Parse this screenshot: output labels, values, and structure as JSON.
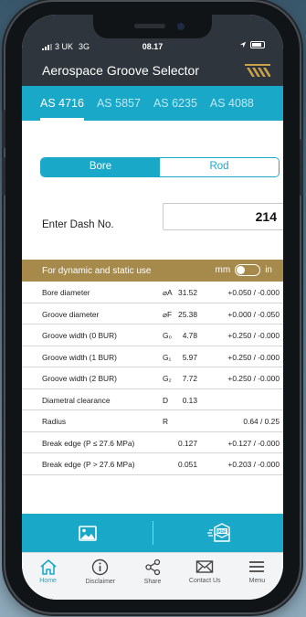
{
  "status": {
    "carrier": "3 UK",
    "network": "3G",
    "time": "08.17"
  },
  "app": {
    "title": "Aerospace Groove Selector",
    "logo_icon": "brand-logo-icon"
  },
  "tabs": [
    {
      "label": "AS 4716",
      "active": true
    },
    {
      "label": "AS 5857",
      "active": false
    },
    {
      "label": "AS 6235",
      "active": false
    },
    {
      "label": "AS 4088",
      "active": false
    }
  ],
  "segment": {
    "bore": "Bore",
    "rod": "Rod",
    "selected": "Bore"
  },
  "dash": {
    "label": "Enter Dash No.",
    "value": "214"
  },
  "usage": {
    "note": "For dynamic and static use",
    "unit_mm": "mm",
    "unit_in": "in",
    "selected_unit": "mm"
  },
  "table": {
    "rows": [
      {
        "name": "Bore diameter",
        "symbol": "⌀A",
        "value": "31.52",
        "tolerance": "+0.050 / -0.000"
      },
      {
        "name": "Groove diameter",
        "symbol": "⌀F",
        "value": "25.38",
        "tolerance": "+0.000 / -0.050"
      },
      {
        "name": "Groove width (0 BUR)",
        "symbol": "G₀",
        "value": "4.78",
        "tolerance": "+0.250 / -0.000"
      },
      {
        "name": "Groove width (1 BUR)",
        "symbol": "G₁",
        "value": "5.97",
        "tolerance": "+0.250 / -0.000"
      },
      {
        "name": "Groove width (2 BUR)",
        "symbol": "G₂",
        "value": "7.72",
        "tolerance": "+0.250 / -0.000"
      },
      {
        "name": "Diametral clearance",
        "symbol": "D",
        "value": "0.13",
        "tolerance": ""
      },
      {
        "name": "Radius",
        "symbol": "R",
        "value": "",
        "tolerance": "0.64 / 0.25"
      },
      {
        "name": "Break edge (P ≤ 27.6 MPa)",
        "symbol": "",
        "value": "0.127",
        "tolerance": "+0.127 / -0.000"
      },
      {
        "name": "Break edge (P > 27.6 MPa)",
        "symbol": "",
        "value": "0.051",
        "tolerance": "+0.203 / -0.000"
      }
    ]
  },
  "toolbar": {
    "left_icon": "image-icon",
    "right_icon": "pdf-email-icon"
  },
  "nav": [
    {
      "label": "Home",
      "icon": "home-icon",
      "active": true
    },
    {
      "label": "Disclaimer",
      "icon": "info-icon",
      "active": false
    },
    {
      "label": "Share",
      "icon": "share-icon",
      "active": false
    },
    {
      "label": "Contact Us",
      "icon": "mail-icon",
      "active": false
    },
    {
      "label": "Menu",
      "icon": "menu-icon",
      "active": false
    }
  ],
  "colors": {
    "accent": "#1aa8c9",
    "header": "#2f353c",
    "gold": "#a58a4c"
  }
}
